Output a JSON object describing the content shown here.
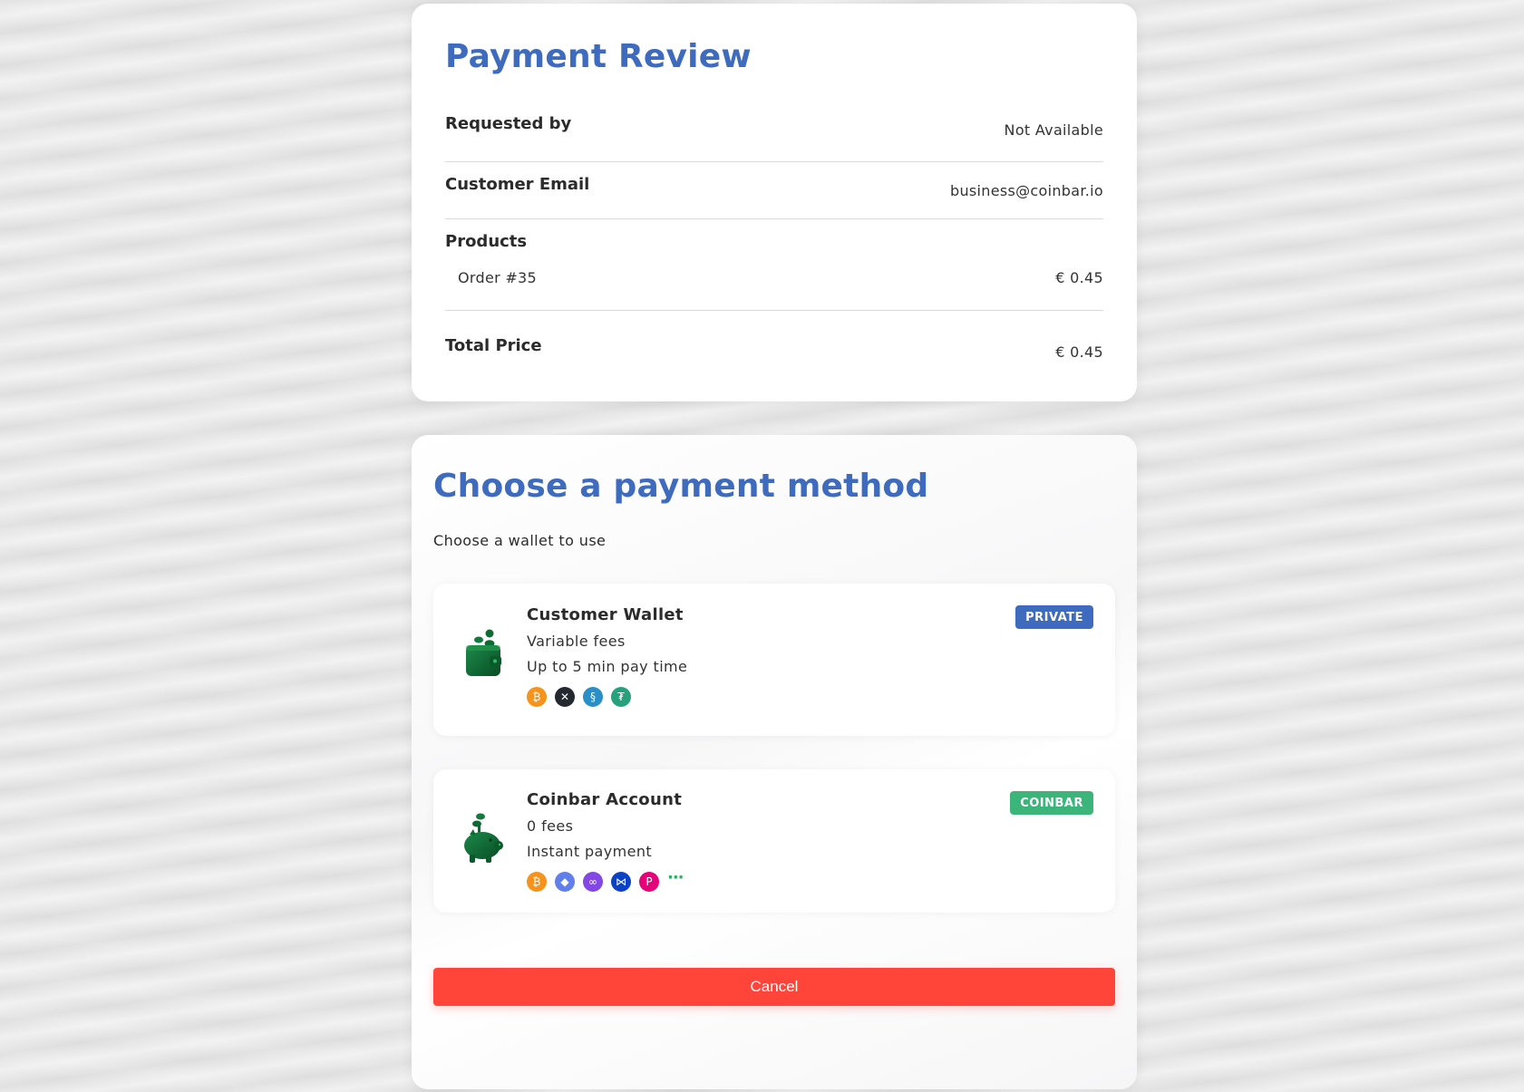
{
  "review": {
    "title": "Payment Review",
    "requested_by_label": "Requested by",
    "requested_by_value": "Not Available",
    "email_label": "Customer Email",
    "email_value": "business@coinbar.io",
    "products_label": "Products",
    "products": [
      {
        "name": "Order #35",
        "price": "€ 0.45"
      }
    ],
    "total_label": "Total Price",
    "total_value": "€ 0.45"
  },
  "payment": {
    "title": "Choose a payment method",
    "subtitle": "Choose a wallet to use",
    "wallets": [
      {
        "name": "Customer Wallet",
        "fees": "Variable fees",
        "pay_time": "Up to 5 min pay time",
        "badge": "PRIVATE",
        "badge_color": "#3f6bbf",
        "icon": "wallet-icon",
        "coins": [
          {
            "name": "bitcoin-icon",
            "glyph": "₿",
            "color": "#f7931a"
          },
          {
            "name": "xrp-icon",
            "glyph": "✕",
            "color": "#23292f"
          },
          {
            "name": "stellar-icon",
            "glyph": "§",
            "color": "#2a8fc7"
          },
          {
            "name": "tether-icon",
            "glyph": "₮",
            "color": "#26a17b"
          }
        ]
      },
      {
        "name": "Coinbar Account",
        "fees": "0 fees",
        "pay_time": "Instant payment",
        "badge": "COINBAR",
        "badge_color": "#3bb57a",
        "icon": "piggy-bank-icon",
        "coins": [
          {
            "name": "bitcoin-icon",
            "glyph": "₿",
            "color": "#f7931a"
          },
          {
            "name": "ethereum-icon",
            "glyph": "◆",
            "color": "#627eea"
          },
          {
            "name": "polygon-icon",
            "glyph": "∞",
            "color": "#8247e5"
          },
          {
            "name": "bancor-icon",
            "glyph": "⋈",
            "color": "#0b41c6"
          },
          {
            "name": "polkadot-icon",
            "glyph": "P",
            "color": "#e6007a"
          }
        ],
        "more": "···"
      }
    ],
    "cancel_label": "Cancel"
  },
  "colors": {
    "title_blue": "#3f6bbf",
    "cancel_red": "#ff4439",
    "wallet_green": "#0f6b35"
  }
}
